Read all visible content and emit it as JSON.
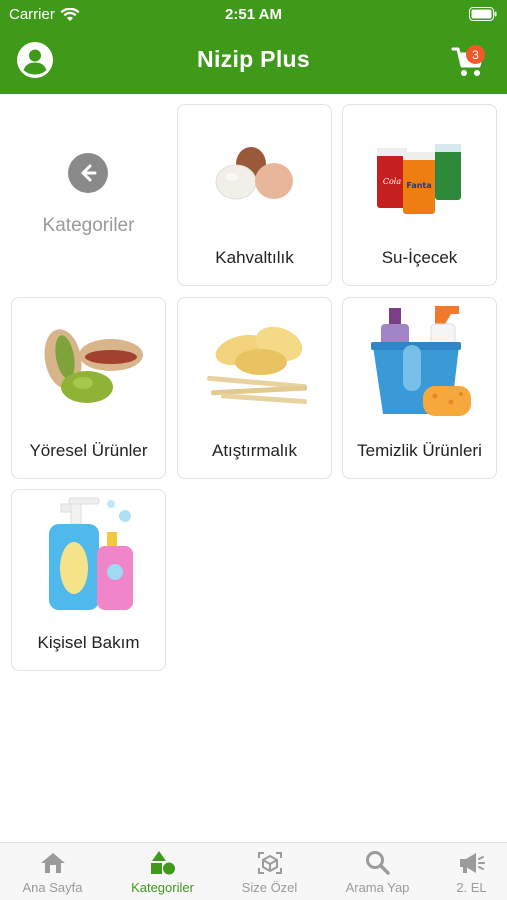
{
  "status": {
    "carrier": "Carrier",
    "time": "2:51 AM"
  },
  "header": {
    "title": "Nizip Plus",
    "cart_count": "3"
  },
  "colors": {
    "brand": "#3f9a1a",
    "badge": "#f2582a",
    "inactive": "#9b9b9b"
  },
  "back": {
    "label": "Kategoriler",
    "icon": "arrow-left-icon"
  },
  "categories": [
    {
      "label": "Kahvaltılık",
      "icon": "eggs-icon"
    },
    {
      "label": "Su-İçecek",
      "icon": "drinks-icon"
    },
    {
      "label": "Yöresel Ürünler",
      "icon": "pistachio-icon"
    },
    {
      "label": "Atıştırmalık",
      "icon": "chips-icon"
    },
    {
      "label": "Temizlik Ürünleri",
      "icon": "cleaning-icon"
    },
    {
      "label": "Kişisel Bakım",
      "icon": "shampoo-icon"
    }
  ],
  "tabs": [
    {
      "label": "Ana Sayfa",
      "icon": "house-icon",
      "active": false
    },
    {
      "label": "Kategoriler",
      "icon": "shapes-icon",
      "active": true
    },
    {
      "label": "Size Özel",
      "icon": "box-icon",
      "active": false
    },
    {
      "label": "Arama Yap",
      "icon": "search-icon",
      "active": false
    },
    {
      "label": "2. EL",
      "icon": "megaphone-icon",
      "active": false
    }
  ]
}
